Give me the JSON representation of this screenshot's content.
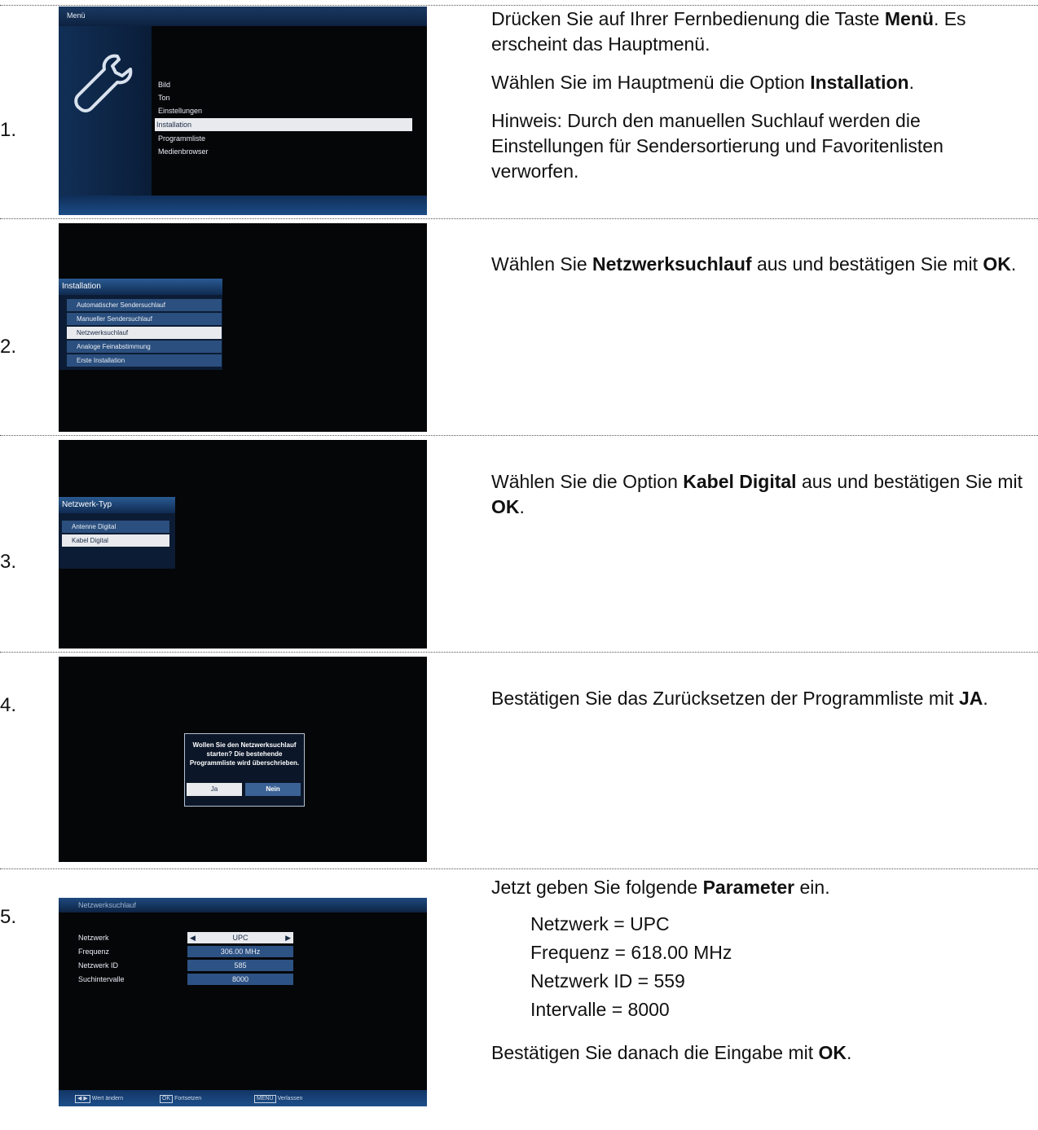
{
  "steps": [
    {
      "number": "1.",
      "screen": {
        "title": "Menü",
        "items": [
          "Bild",
          "Ton",
          "Einstellungen",
          "Installation",
          "Programmliste",
          "Medienbrowser"
        ],
        "selected_index": 3
      },
      "text": [
        [
          "Drücken Sie auf Ihrer Fernbedienung die Taste ",
          "Menü",
          ". Es erscheint das Hauptmenü."
        ],
        [
          "Wählen Sie im Hauptmenü die Option ",
          "Installation",
          "."
        ],
        [
          "Hinweis: Durch den manuellen Suchlauf werden die Einstellungen für Sendersortierung und Favoritenlisten verworfen.",
          "",
          ""
        ]
      ]
    },
    {
      "number": "2.",
      "screen": {
        "title": "Installation",
        "items": [
          "Automatischer Sendersuchlauf",
          "Manueller Sendersuchlauf",
          "Netzwerksuchlauf",
          "Analoge Feinabstimmung",
          "Erste Installation"
        ],
        "selected_index": 2
      },
      "text": [
        [
          "Wählen Sie ",
          "Netzwerksuchlauf",
          " aus und bestätigen Sie mit "
        ],
        [
          "",
          "OK",
          "."
        ]
      ]
    },
    {
      "number": "3.",
      "screen": {
        "title": "Netzwerk-Typ",
        "items": [
          "Antenne Digital",
          "Kabel Digital"
        ],
        "selected_index": 1
      },
      "text": [
        [
          "Wählen Sie die Option ",
          "Kabel Digital",
          " aus und bestätigen Sie mit "
        ],
        [
          "",
          "OK",
          "."
        ]
      ]
    },
    {
      "number": "4.",
      "screen": {
        "message": "Wollen Sie den Netzwerksuchlauf starten? Die bestehende Programmliste wird überschrieben.",
        "yes": "Ja",
        "no": "Nein"
      },
      "text": [
        [
          "Bestätigen Sie das Zurücksetzen der Programmliste mit ",
          "JA",
          "."
        ]
      ]
    },
    {
      "number": "5.",
      "screen": {
        "title": "Netzwerksuchlauf",
        "rows": [
          {
            "label": "Netzwerk",
            "value": "UPC"
          },
          {
            "label": "Frequenz",
            "value": "306.00 MHz"
          },
          {
            "label": "Netzwerk ID",
            "value": "585"
          },
          {
            "label": "Suchintervalle",
            "value": "8000"
          }
        ],
        "footer": [
          {
            "key": "◀ ▶",
            "label": "Wert ändern"
          },
          {
            "key": "OK",
            "label": "Fortsetzen"
          },
          {
            "key": "MENU",
            "label": "Verlassen"
          }
        ]
      },
      "intro": [
        "Jetzt geben Sie folgende ",
        "Parameter",
        " ein."
      ],
      "params": [
        "Netzwerk = UPC",
        "Frequenz = 618.00 MHz",
        "Netzwerk ID = 559",
        "Intervalle = 8000"
      ],
      "outro": [
        "Bestätigen Sie danach die Eingabe mit ",
        "OK",
        "."
      ]
    }
  ]
}
